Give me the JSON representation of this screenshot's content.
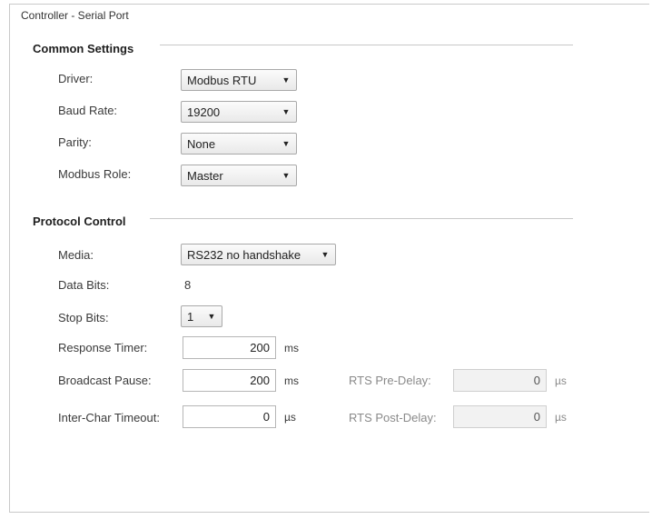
{
  "window": {
    "title": "Controller - Serial Port"
  },
  "common_settings": {
    "header": "Common Settings",
    "driver": {
      "label": "Driver:",
      "value": "Modbus RTU"
    },
    "baud_rate": {
      "label": "Baud Rate:",
      "value": "19200"
    },
    "parity": {
      "label": "Parity:",
      "value": "None"
    },
    "modbus_role": {
      "label": "Modbus Role:",
      "value": "Master"
    }
  },
  "protocol_control": {
    "header": "Protocol Control",
    "media": {
      "label": "Media:",
      "value": "RS232 no handshake"
    },
    "data_bits": {
      "label": "Data Bits:",
      "value": "8"
    },
    "stop_bits": {
      "label": "Stop Bits:",
      "value": "1"
    },
    "response_timer": {
      "label": "Response Timer:",
      "value": "200",
      "unit": "ms"
    },
    "broadcast_pause": {
      "label": "Broadcast Pause:",
      "value": "200",
      "unit": "ms"
    },
    "inter_char_timeout": {
      "label": "Inter-Char Timeout:",
      "value": "0",
      "unit": "µs"
    },
    "rts_pre_delay": {
      "label": "RTS Pre-Delay:",
      "value": "0",
      "unit": "µs"
    },
    "rts_post_delay": {
      "label": "RTS Post-Delay:",
      "value": "0",
      "unit": "µs"
    }
  },
  "icons": {
    "dropdown_arrow": "chevron-down-icon"
  }
}
